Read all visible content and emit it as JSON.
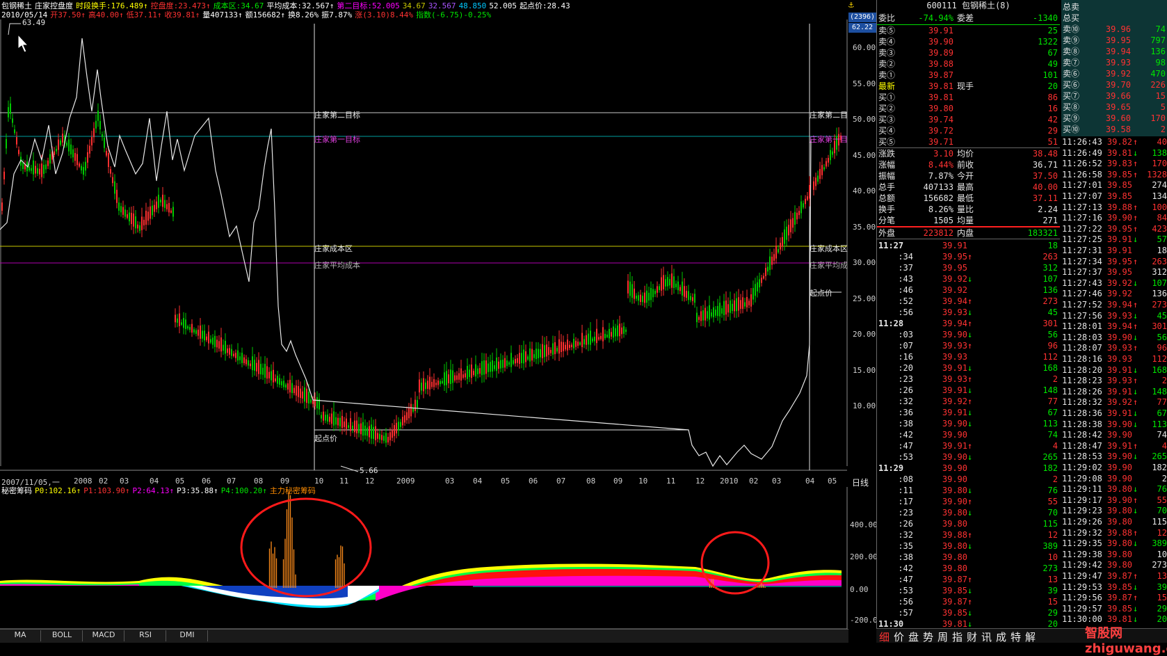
{
  "header": {
    "line1": [
      {
        "text": "包钢稀土",
        "color": "#ffffff"
      },
      {
        "text": "庄家控盘度",
        "color": "#ffffff"
      },
      {
        "text": "时段换手:176.489↑",
        "color": "#ffff00"
      },
      {
        "text": "控盘度:23.473↑",
        "color": "#ff3232"
      },
      {
        "text": "成本区:34.67",
        "color": "#00e600"
      },
      {
        "text": "平均成本:32.567↑",
        "color": "#ffffff"
      },
      {
        "text": "第二目标:52.005",
        "color": "#ff00ff"
      },
      {
        "text": "34.67",
        "color": "#c8c800"
      },
      {
        "text": "32.567",
        "color": "#aa55ff"
      },
      {
        "text": "48.850",
        "color": "#00c8ff"
      },
      {
        "text": "52.005",
        "color": "#ffffff"
      },
      {
        "text": "起点价:28.43",
        "color": "#ffffff"
      }
    ],
    "line2": [
      {
        "text": "2010/05/14",
        "color": "#ffffff"
      },
      {
        "text": "开37.50↑",
        "color": "#ff3232"
      },
      {
        "text": "高40.00↑",
        "color": "#ff3232"
      },
      {
        "text": "低37.11↑",
        "color": "#ff3232"
      },
      {
        "text": "收39.81↑",
        "color": "#ff3232"
      },
      {
        "text": "量407133↑",
        "color": "#ffffff"
      },
      {
        "text": "额156682↑",
        "color": "#ffffff"
      },
      {
        "text": "换8.26%",
        "color": "#ffffff"
      },
      {
        "text": "振7.87%",
        "color": "#ffffff"
      },
      {
        "text": "涨(3.10)8.44%",
        "color": "#ff3232"
      },
      {
        "text": "指数(-6.75)-0.25%",
        "color": "#00e600"
      }
    ]
  },
  "main_chart": {
    "high_label": "63.49",
    "low_label": "5.66",
    "y_ticks": [
      "60.00",
      "55.00",
      "50.00",
      "45.00",
      "40.00",
      "35.00",
      "30.00",
      "25.00",
      "20.00",
      "15.00",
      "10.00"
    ],
    "x_ticks": [
      "2007/11/05,一",
      "2008",
      "02",
      "03",
      "04",
      "05",
      "06",
      "07",
      "08",
      "09",
      "10",
      "11",
      "12",
      "2009",
      "03",
      "04",
      "05",
      "06",
      "07",
      "08",
      "09",
      "10",
      "11",
      "12",
      "2010",
      "02",
      "03",
      "04",
      "05"
    ],
    "period_label": "日线",
    "top_badge": "(2396)",
    "price_badge": "62.22",
    "levels": {
      "second_target": "庄家第二目标",
      "first_target": "庄家第一目标",
      "cost_zone": "庄家成本区",
      "avg_cost": "庄家平均成本",
      "start_price": "起点价",
      "second_target_short": "庄家第二目",
      "first_target_short": "庄家第一目",
      "cost_zone_short": "庄家成本区",
      "avg_cost_short": "庄家平均成",
      "start_price_short": "起点价"
    }
  },
  "sub_chart": {
    "title": "秘密筹码",
    "indicators": [
      {
        "text": "P0:102.16↑",
        "color": "#ffff00"
      },
      {
        "text": "P1:103.90↑",
        "color": "#ff3232"
      },
      {
        "text": "P2:64.13↑",
        "color": "#ff00ff"
      },
      {
        "text": "P3:35.88↑",
        "color": "#ffffff"
      },
      {
        "text": "P4:100.20↑",
        "color": "#00e600"
      },
      {
        "text": "主力秘密筹码",
        "color": "#ff8c00"
      }
    ],
    "y_ticks": [
      "400.00",
      "200.00",
      "0.00",
      "-200.0"
    ]
  },
  "bottom_tabs": [
    "MA",
    "BOLL",
    "MACD",
    "RSI",
    "DMI"
  ],
  "quote": {
    "code": "600111",
    "name": "包钢稀土",
    "count": "(8)",
    "weibi_label": "委比",
    "weibi": "-74.94%",
    "weicha_label": "委差",
    "weicha": "-1340",
    "sell": [
      {
        "label": "卖⑤",
        "price": "39.91",
        "vol": "25"
      },
      {
        "label": "卖④",
        "price": "39.90",
        "vol": "1322"
      },
      {
        "label": "卖③",
        "price": "39.89",
        "vol": "67"
      },
      {
        "label": "卖②",
        "price": "39.88",
        "vol": "49"
      },
      {
        "label": "卖①",
        "price": "39.87",
        "vol": "101"
      }
    ],
    "latest_label": "最新",
    "latest": "39.81",
    "xianshou_label": "现手",
    "xianshou": "20",
    "buy": [
      {
        "label": "买①",
        "price": "39.81",
        "vol": "86"
      },
      {
        "label": "买②",
        "price": "39.80",
        "vol": "16"
      },
      {
        "label": "买③",
        "price": "39.74",
        "vol": "42"
      },
      {
        "label": "买④",
        "price": "39.72",
        "vol": "29"
      },
      {
        "label": "买⑤",
        "price": "39.71",
        "vol": "51"
      }
    ],
    "stats": [
      {
        "l1": "涨跌",
        "v1": "3.10",
        "c1": "#ff3232",
        "l2": "均价",
        "v2": "38.48",
        "c2": "#ff3232"
      },
      {
        "l1": "涨幅",
        "v1": "8.44%",
        "c1": "#ff3232",
        "l2": "前收",
        "v2": "36.71",
        "c2": "#e6e6e6"
      },
      {
        "l1": "振幅",
        "v1": "7.87%",
        "c1": "#e6e6e6",
        "l2": "今开",
        "v2": "37.50",
        "c2": "#ff3232"
      },
      {
        "l1": "总手",
        "v1": "407133",
        "c1": "#e6e6e6",
        "l2": "最高",
        "v2": "40.00",
        "c2": "#ff3232"
      },
      {
        "l1": "总额",
        "v1": "156682",
        "c1": "#e6e6e6",
        "l2": "最低",
        "v2": "37.11",
        "c2": "#ff3232"
      },
      {
        "l1": "换手",
        "v1": "8.26%",
        "c1": "#e6e6e6",
        "l2": "量比",
        "v2": "2.24",
        "c2": "#e6e6e6"
      },
      {
        "l1": "分笔",
        "v1": "1505",
        "c1": "#e6e6e6",
        "l2": "均量",
        "v2": "271",
        "c2": "#e6e6e6"
      }
    ],
    "waipan_label": "外盘",
    "waipan": "223812",
    "neipan_label": "内盘",
    "neipan": "183321"
  },
  "ticks": [
    {
      "t": "11:27",
      "p": "39.91",
      "a": "",
      "v": "18",
      "pc": "#ff3232",
      "vc": "#00e600",
      "bold": true
    },
    {
      "t": ":34",
      "p": "39.95",
      "a": "↑",
      "v": "263",
      "pc": "#ff3232",
      "vc": "#ff3232"
    },
    {
      "t": ":37",
      "p": "39.95",
      "a": "",
      "v": "312",
      "pc": "#ff3232",
      "vc": "#00e600"
    },
    {
      "t": ":43",
      "p": "39.92",
      "a": "↓",
      "v": "107",
      "pc": "#ff3232",
      "vc": "#00e600"
    },
    {
      "t": ":46",
      "p": "39.92",
      "a": "",
      "v": "136",
      "pc": "#ff3232",
      "vc": "#00e600"
    },
    {
      "t": ":52",
      "p": "39.94",
      "a": "↑",
      "v": "273",
      "pc": "#ff3232",
      "vc": "#ff3232"
    },
    {
      "t": ":56",
      "p": "39.93",
      "a": "↓",
      "v": "45",
      "pc": "#ff3232",
      "vc": "#00e600"
    },
    {
      "t": "11:28",
      "p": "39.94",
      "a": "↑",
      "v": "301",
      "pc": "#ff3232",
      "vc": "#ff3232",
      "bold": true
    },
    {
      "t": ":03",
      "p": "39.90",
      "a": "↓",
      "v": "56",
      "pc": "#ff3232",
      "vc": "#00e600"
    },
    {
      "t": ":07",
      "p": "39.93",
      "a": "↑",
      "v": "96",
      "pc": "#ff3232",
      "vc": "#ff3232"
    },
    {
      "t": ":16",
      "p": "39.93",
      "a": "",
      "v": "112",
      "pc": "#ff3232",
      "vc": "#ff3232"
    },
    {
      "t": ":20",
      "p": "39.91",
      "a": "↓",
      "v": "168",
      "pc": "#ff3232",
      "vc": "#00e600"
    },
    {
      "t": ":23",
      "p": "39.93",
      "a": "↑",
      "v": "2",
      "pc": "#ff3232",
      "vc": "#ff3232"
    },
    {
      "t": ":26",
      "p": "39.91",
      "a": "↓",
      "v": "148",
      "pc": "#ff3232",
      "vc": "#00e600"
    },
    {
      "t": ":32",
      "p": "39.92",
      "a": "↑",
      "v": "77",
      "pc": "#ff3232",
      "vc": "#ff3232"
    },
    {
      "t": ":36",
      "p": "39.91",
      "a": "↓",
      "v": "67",
      "pc": "#ff3232",
      "vc": "#00e600"
    },
    {
      "t": ":38",
      "p": "39.90",
      "a": "↓",
      "v": "113",
      "pc": "#ff3232",
      "vc": "#00e600"
    },
    {
      "t": ":42",
      "p": "39.90",
      "a": "",
      "v": "74",
      "pc": "#ff3232",
      "vc": "#00e600"
    },
    {
      "t": ":47",
      "p": "39.91",
      "a": "↑",
      "v": "4",
      "pc": "#ff3232",
      "vc": "#ff3232"
    },
    {
      "t": ":53",
      "p": "39.90",
      "a": "↓",
      "v": "265",
      "pc": "#ff3232",
      "vc": "#00e600"
    },
    {
      "t": "11:29",
      "p": "39.90",
      "a": "",
      "v": "182",
      "pc": "#ff3232",
      "vc": "#00e600",
      "bold": true
    },
    {
      "t": ":08",
      "p": "39.90",
      "a": "",
      "v": "2",
      "pc": "#ff3232",
      "vc": "#ff3232"
    },
    {
      "t": ":11",
      "p": "39.80",
      "a": "↓",
      "v": "76",
      "pc": "#ff3232",
      "vc": "#00e600"
    },
    {
      "t": ":17",
      "p": "39.90",
      "a": "↑",
      "v": "55",
      "pc": "#ff3232",
      "vc": "#ff3232"
    },
    {
      "t": ":23",
      "p": "39.80",
      "a": "↓",
      "v": "70",
      "pc": "#ff3232",
      "vc": "#00e600"
    },
    {
      "t": ":26",
      "p": "39.80",
      "a": "",
      "v": "115",
      "pc": "#ff3232",
      "vc": "#00e600"
    },
    {
      "t": ":32",
      "p": "39.88",
      "a": "↑",
      "v": "12",
      "pc": "#ff3232",
      "vc": "#ff3232"
    },
    {
      "t": ":35",
      "p": "39.80",
      "a": "↓",
      "v": "389",
      "pc": "#ff3232",
      "vc": "#00e600"
    },
    {
      "t": ":38",
      "p": "39.80",
      "a": "",
      "v": "10",
      "pc": "#ff3232",
      "vc": "#ff3232"
    },
    {
      "t": ":42",
      "p": "39.80",
      "a": "",
      "v": "273",
      "pc": "#ff3232",
      "vc": "#00e600"
    },
    {
      "t": ":47",
      "p": "39.87",
      "a": "↑",
      "v": "13",
      "pc": "#ff3232",
      "vc": "#ff3232"
    },
    {
      "t": ":53",
      "p": "39.85",
      "a": "↓",
      "v": "39",
      "pc": "#ff3232",
      "vc": "#00e600"
    },
    {
      "t": ":56",
      "p": "39.87",
      "a": "↑",
      "v": "15",
      "pc": "#ff3232",
      "vc": "#ff3232"
    },
    {
      "t": ":57",
      "p": "39.85",
      "a": "↓",
      "v": "29",
      "pc": "#ff3232",
      "vc": "#00e600"
    },
    {
      "t": "11:30",
      "p": "39.81",
      "a": "↓",
      "v": "20",
      "pc": "#ff3232",
      "vc": "#00e600",
      "bold": true
    }
  ],
  "side": {
    "total_sell_label": "总卖",
    "total_buy_label": "总买",
    "sell": [
      {
        "label": "卖⑩",
        "price": "39.96",
        "vol": "74"
      },
      {
        "label": "卖⑨",
        "price": "39.95",
        "vol": "797"
      },
      {
        "label": "卖⑧",
        "price": "39.94",
        "vol": "136"
      },
      {
        "label": "卖⑦",
        "price": "39.93",
        "vol": "98"
      },
      {
        "label": "卖⑥",
        "price": "39.92",
        "vol": "470"
      }
    ],
    "buy": [
      {
        "label": "买⑥",
        "price": "39.70",
        "vol": "226"
      },
      {
        "label": "买⑦",
        "price": "39.66",
        "vol": "15"
      },
      {
        "label": "买⑧",
        "price": "39.65",
        "vol": "5"
      },
      {
        "label": "买⑨",
        "price": "39.60",
        "vol": "170"
      },
      {
        "label": "买⑩",
        "price": "39.58",
        "vol": "2"
      }
    ],
    "ticks": [
      {
        "t": "11:26:43",
        "p": "39.82",
        "a": "↑",
        "v": "40",
        "vc": "#ff3232"
      },
      {
        "t": "11:26:49",
        "p": "39.81",
        "a": "↓",
        "v": "138",
        "vc": "#00e600"
      },
      {
        "t": "11:26:52",
        "p": "39.83",
        "a": "↑",
        "v": "170",
        "vc": "#ff3232"
      },
      {
        "t": "11:26:58",
        "p": "39.85",
        "a": "↑",
        "v": "1328",
        "vc": "#ff3232"
      },
      {
        "t": "11:27:01",
        "p": "39.85",
        "a": "",
        "v": "274",
        "vc": "#e6e6e6"
      },
      {
        "t": "11:27:07",
        "p": "39.85",
        "a": "",
        "v": "134",
        "vc": "#e6e6e6"
      },
      {
        "t": "11:27:13",
        "p": "39.88",
        "a": "↑",
        "v": "100",
        "vc": "#ff3232"
      },
      {
        "t": "11:27:16",
        "p": "39.90",
        "a": "↑",
        "v": "84",
        "vc": "#ff3232"
      },
      {
        "t": "11:27:22",
        "p": "39.95",
        "a": "↑",
        "v": "423",
        "vc": "#ff3232"
      },
      {
        "t": "11:27:25",
        "p": "39.91",
        "a": "↓",
        "v": "57",
        "vc": "#00e600"
      },
      {
        "t": "11:27:31",
        "p": "39.91",
        "a": "",
        "v": "18",
        "vc": "#e6e6e6"
      },
      {
        "t": "11:27:34",
        "p": "39.95",
        "a": "↑",
        "v": "263",
        "vc": "#ff3232"
      },
      {
        "t": "11:27:37",
        "p": "39.95",
        "a": "",
        "v": "312",
        "vc": "#e6e6e6"
      },
      {
        "t": "11:27:43",
        "p": "39.92",
        "a": "↓",
        "v": "107",
        "vc": "#00e600"
      },
      {
        "t": "11:27:46",
        "p": "39.92",
        "a": "",
        "v": "136",
        "vc": "#e6e6e6"
      },
      {
        "t": "11:27:52",
        "p": "39.94",
        "a": "↑",
        "v": "273",
        "vc": "#ff3232"
      },
      {
        "t": "11:27:56",
        "p": "39.93",
        "a": "↓",
        "v": "45",
        "vc": "#00e600"
      },
      {
        "t": "11:28:01",
        "p": "39.94",
        "a": "↑",
        "v": "301",
        "vc": "#ff3232"
      },
      {
        "t": "11:28:03",
        "p": "39.90",
        "a": "↓",
        "v": "56",
        "vc": "#00e600"
      },
      {
        "t": "11:28:07",
        "p": "39.93",
        "a": "↑",
        "v": "96",
        "vc": "#ff3232"
      },
      {
        "t": "11:28:16",
        "p": "39.93",
        "a": "",
        "v": "112",
        "vc": "#ff3232"
      },
      {
        "t": "11:28:20",
        "p": "39.91",
        "a": "↓",
        "v": "168",
        "vc": "#00e600"
      },
      {
        "t": "11:28:23",
        "p": "39.93",
        "a": "↑",
        "v": "2",
        "vc": "#ff3232"
      },
      {
        "t": "11:28:26",
        "p": "39.91",
        "a": "↓",
        "v": "148",
        "vc": "#00e600"
      },
      {
        "t": "11:28:32",
        "p": "39.92",
        "a": "↑",
        "v": "77",
        "vc": "#ff3232"
      },
      {
        "t": "11:28:36",
        "p": "39.91",
        "a": "↓",
        "v": "67",
        "vc": "#00e600"
      },
      {
        "t": "11:28:38",
        "p": "39.90",
        "a": "↓",
        "v": "113",
        "vc": "#00e600"
      },
      {
        "t": "11:28:42",
        "p": "39.90",
        "a": "",
        "v": "74",
        "vc": "#e6e6e6"
      },
      {
        "t": "11:28:47",
        "p": "39.91",
        "a": "↑",
        "v": "4",
        "vc": "#ff3232"
      },
      {
        "t": "11:28:53",
        "p": "39.90",
        "a": "↓",
        "v": "265",
        "vc": "#00e600"
      },
      {
        "t": "11:29:02",
        "p": "39.90",
        "a": "",
        "v": "182",
        "vc": "#e6e6e6"
      },
      {
        "t": "11:29:08",
        "p": "39.90",
        "a": "",
        "v": "2",
        "vc": "#e6e6e6"
      },
      {
        "t": "11:29:11",
        "p": "39.80",
        "a": "↓",
        "v": "76",
        "vc": "#00e600"
      },
      {
        "t": "11:29:17",
        "p": "39.90",
        "a": "↑",
        "v": "55",
        "vc": "#ff3232"
      },
      {
        "t": "11:29:23",
        "p": "39.80",
        "a": "↓",
        "v": "70",
        "vc": "#00e600"
      },
      {
        "t": "11:29:26",
        "p": "39.80",
        "a": "",
        "v": "115",
        "vc": "#e6e6e6"
      },
      {
        "t": "11:29:32",
        "p": "39.88",
        "a": "↑",
        "v": "12",
        "vc": "#ff3232"
      },
      {
        "t": "11:29:35",
        "p": "39.80",
        "a": "↓",
        "v": "389",
        "vc": "#00e600"
      },
      {
        "t": "11:29:38",
        "p": "39.80",
        "a": "",
        "v": "10",
        "vc": "#e6e6e6"
      },
      {
        "t": "11:29:42",
        "p": "39.80",
        "a": "",
        "v": "273",
        "vc": "#e6e6e6"
      },
      {
        "t": "11:29:47",
        "p": "39.87",
        "a": "↑",
        "v": "13",
        "vc": "#ff3232"
      },
      {
        "t": "11:29:53",
        "p": "39.85",
        "a": "↓",
        "v": "39",
        "vc": "#00e600"
      },
      {
        "t": "11:29:56",
        "p": "39.87",
        "a": "↑",
        "v": "15",
        "vc": "#ff3232"
      },
      {
        "t": "11:29:57",
        "p": "39.85",
        "a": "↓",
        "v": "29",
        "vc": "#00e600"
      },
      {
        "t": "11:30:00",
        "p": "39.81",
        "a": "↓",
        "v": "20",
        "vc": "#00e600"
      }
    ]
  },
  "func_bar": [
    "细",
    "价",
    "盘",
    "势",
    "周",
    "指",
    "财",
    "讯",
    "成",
    "特",
    "解"
  ],
  "watermark": "智股网 zhiguwang.com"
}
